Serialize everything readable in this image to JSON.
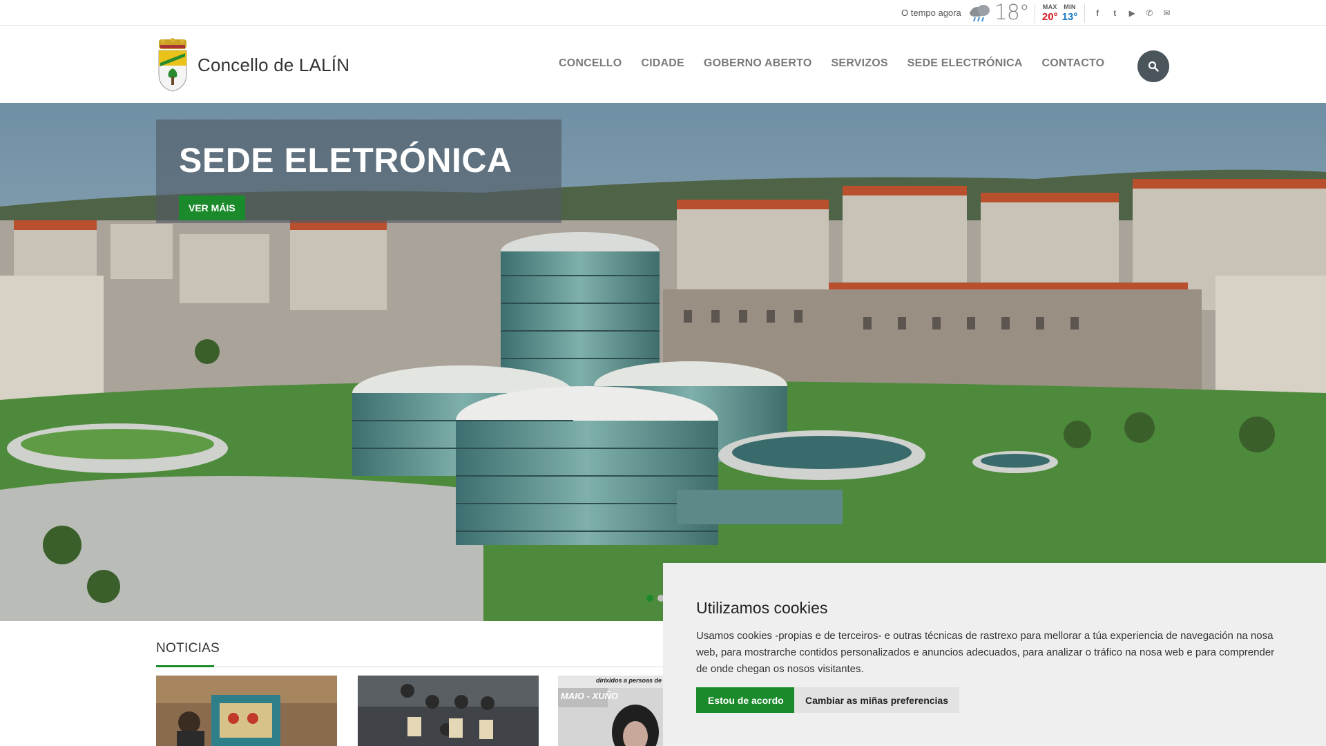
{
  "weather": {
    "label": "O tempo agora",
    "temp": "18°",
    "max_label": "MAX",
    "min_label": "MIN",
    "max_value": "20°",
    "min_value": "13°",
    "icon": "rain-cloud-icon"
  },
  "socials": [
    {
      "name": "facebook-icon",
      "glyph": "f"
    },
    {
      "name": "twitter-icon",
      "glyph": "t"
    },
    {
      "name": "youtube-icon",
      "glyph": "▶"
    },
    {
      "name": "phone-icon",
      "glyph": "✆"
    },
    {
      "name": "mail-icon",
      "glyph": "✉"
    }
  ],
  "header": {
    "site_title": "Concello de LALÍN",
    "nav": [
      "CONCELLO",
      "CIDADE",
      "GOBERNO ABERTO",
      "SERVIZOS",
      "SEDE ELECTRÓNICA",
      "CONTACTO"
    ]
  },
  "hero": {
    "title": "SEDE ELETRÓNICA",
    "button": "VER MÁIS",
    "slides": 2,
    "active_slide": 1
  },
  "news": {
    "title": "NOTICIAS",
    "thumb3_overlay_top": "dirixidos a persoas de m",
    "thumb3_overlay_label": "MAIO - XUÑO"
  },
  "cookie": {
    "title": "Utilizamos cookies",
    "text": "Usamos cookies -propias e de terceiros- e outras técnicas de rastrexo para mellorar a túa experiencia de navegación na nosa web, para mostrarche contidos personalizados e anuncios adecuados, para analizar o tráfico na nosa web e para comprender de onde chegan os nosos visitantes.",
    "accept": "Estou de acordo",
    "prefs": "Cambiar as miñas preferencias"
  },
  "colors": {
    "accent_green": "#1a8a2a",
    "max_red": "#d4161c",
    "min_blue": "#1b79c8",
    "search_bg": "#4b565c"
  }
}
